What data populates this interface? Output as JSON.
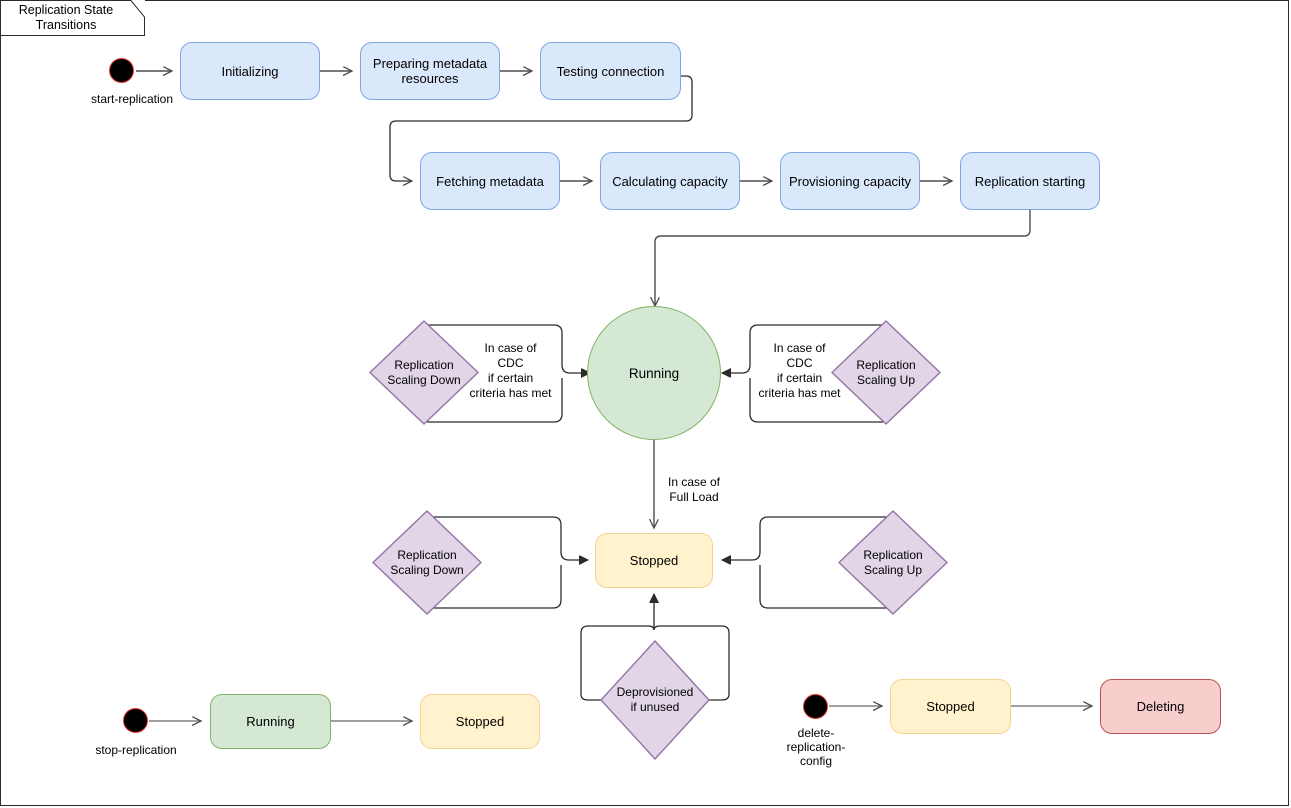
{
  "diagram": {
    "title": "Replication State Transitions",
    "colors": {
      "blue_fill": "#dae8fc",
      "blue_stroke": "#7ea6e0",
      "green_fill": "#d5e8d4",
      "green_stroke": "#82b366",
      "yellow_fill": "#ffe6cc",
      "yellow_stroke": "#f0c987",
      "cream_fill": "#fff2cc",
      "cream_stroke": "#f2d492",
      "red_fill": "#f8cecc",
      "red_stroke": "#b85450",
      "purple_fill": "#e1d5e7",
      "purple_stroke": "#9673a6",
      "start_dot": "#000000",
      "start_ring": "#e53935",
      "edge": "#4d4d4d"
    },
    "start_nodes": [
      {
        "id": "start-replication",
        "label": "start-replication"
      },
      {
        "id": "stop-replication",
        "label": "stop-replication"
      },
      {
        "id": "delete-replication-config",
        "label": "delete-\nreplication-\nconfig"
      }
    ],
    "states": [
      {
        "id": "initializing",
        "label": "Initializing",
        "color": "blue"
      },
      {
        "id": "preparing-metadata",
        "label": "Preparing metadata\nresources",
        "color": "blue"
      },
      {
        "id": "testing-connection",
        "label": "Testing connection",
        "color": "blue"
      },
      {
        "id": "fetching-metadata",
        "label": "Fetching metadata",
        "color": "blue"
      },
      {
        "id": "calculating-capacity",
        "label": "Calculating capacity",
        "color": "blue"
      },
      {
        "id": "provisioning-capacity",
        "label": "Provisioning capacity",
        "color": "blue"
      },
      {
        "id": "replication-starting",
        "label": "Replication starting",
        "color": "blue"
      },
      {
        "id": "running-main",
        "label": "Running",
        "color": "green"
      },
      {
        "id": "stopped-main",
        "label": "Stopped",
        "color": "cream"
      },
      {
        "id": "running-stop-flow",
        "label": "Running",
        "color": "green"
      },
      {
        "id": "stopped-stop-flow",
        "label": "Stopped",
        "color": "cream"
      },
      {
        "id": "stopped-delete-flow",
        "label": "Stopped",
        "color": "cream"
      },
      {
        "id": "deleting",
        "label": "Deleting",
        "color": "red"
      }
    ],
    "decisions": [
      {
        "id": "scaling-down-running",
        "label": "Replication\nScaling Down"
      },
      {
        "id": "scaling-up-running",
        "label": "Replication\nScaling Up"
      },
      {
        "id": "scaling-down-stopped",
        "label": "Replication\nScaling Down"
      },
      {
        "id": "scaling-up-stopped",
        "label": "Replication\nScaling Up"
      },
      {
        "id": "deprovisioned",
        "label": "Deprovisioned\nif unused"
      }
    ],
    "edge_labels": [
      {
        "id": "cdc-left",
        "label": "In case of\nCDC\nif certain\ncriteria has met"
      },
      {
        "id": "cdc-right",
        "label": "In case of\nCDC\nif certain\ncriteria has met"
      },
      {
        "id": "full-load",
        "label": "In case of\nFull Load"
      }
    ]
  }
}
